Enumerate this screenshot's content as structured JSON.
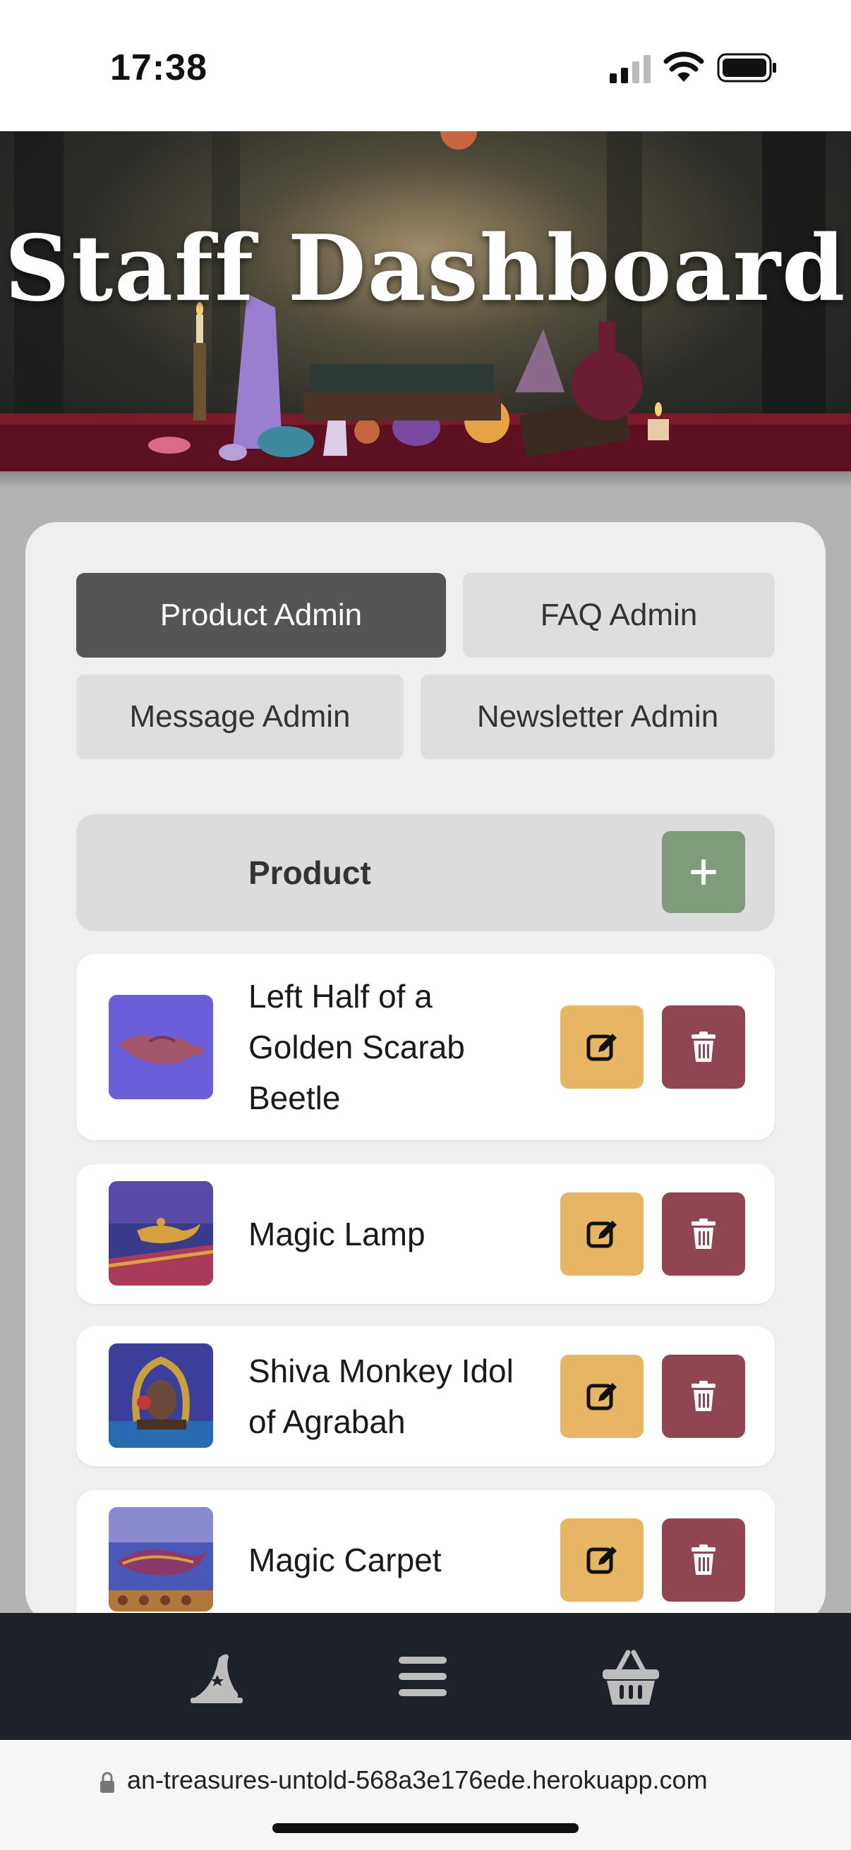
{
  "status_bar": {
    "time": "17:38",
    "icons": [
      "signal-icon",
      "wifi-icon",
      "battery-icon"
    ]
  },
  "hero": {
    "title": "Staff Dashboard"
  },
  "tabs": [
    {
      "label": "Product Admin",
      "active": true
    },
    {
      "label": "FAQ Admin",
      "active": false
    },
    {
      "label": "Message Admin",
      "active": false
    },
    {
      "label": "Newsletter Admin",
      "active": false
    }
  ],
  "product_section": {
    "header": "Product",
    "add_icon": "plus-icon"
  },
  "products": [
    {
      "name": "Left Half of a Golden Scarab Beetle",
      "thumb": "scarab-image"
    },
    {
      "name": "Magic Lamp",
      "thumb": "lamp-image"
    },
    {
      "name": "Shiva Monkey Idol of Agrabah",
      "thumb": "idol-image"
    },
    {
      "name": "Magic Carpet",
      "thumb": "carpet-image"
    }
  ],
  "row_actions": {
    "edit_icon": "edit-icon",
    "delete_icon": "trash-icon"
  },
  "bottom_nav": {
    "items": [
      "wizard-hat-icon",
      "menu-icon",
      "basket-icon"
    ]
  },
  "url_bar": {
    "url": "an-treasures-untold-568a3e176ede.herokuapp.com"
  },
  "colors": {
    "active_tab": "#555555",
    "inactive_tab": "#dedede",
    "add_button": "#7f9c7a",
    "edit_button": "#e6b664",
    "delete_button": "#8f4652",
    "nav_background": "#1d222a"
  }
}
